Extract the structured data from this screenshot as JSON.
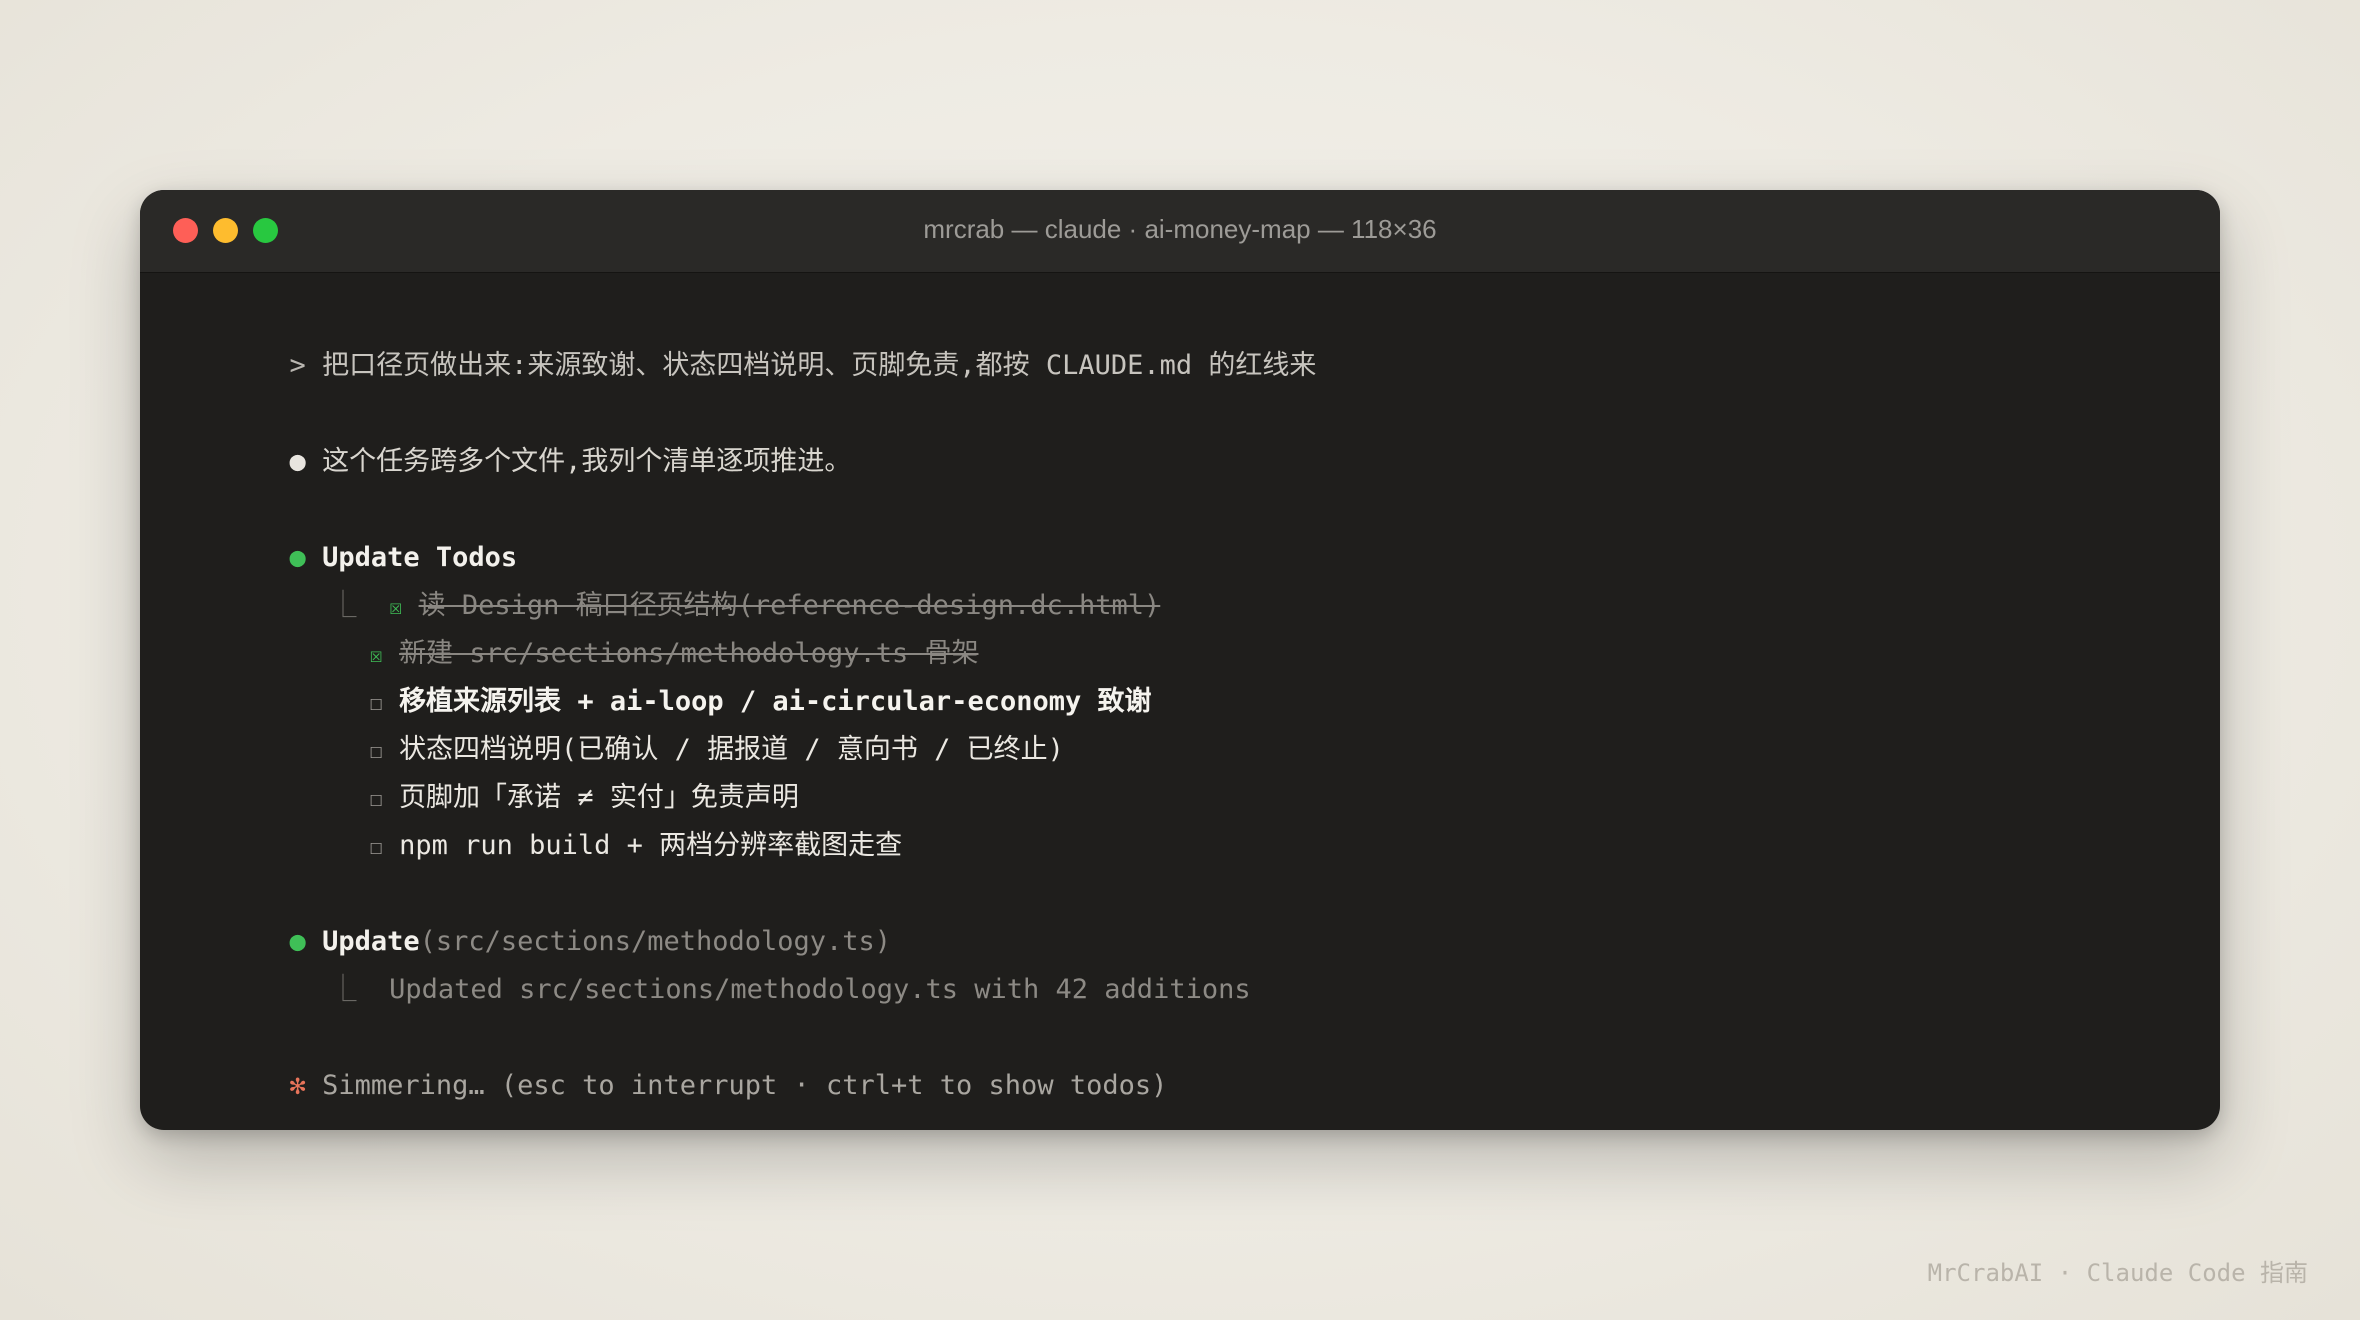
{
  "window": {
    "title": "mrcrab — claude · ai-money-map — 118×36"
  },
  "prompt": {
    "mark": ">",
    "text": "把口径页做出来:来源致谢、状态四档说明、页脚免责,都按 CLAUDE.md 的红线来"
  },
  "reply": {
    "text": "这个任务跨多个文件,我列个清单逐项推进。"
  },
  "todos": {
    "heading": "Update Todos",
    "items": [
      {
        "check": "☒",
        "label": "读 Design 稿口径页结构(reference-design.dc.html)",
        "status": "done"
      },
      {
        "check": "☒",
        "label": "新建 src/sections/methodology.ts 骨架",
        "status": "done"
      },
      {
        "check": "☐",
        "label": "移植来源列表 + ai-loop / ai-circular-economy 致谢",
        "status": "in_progress"
      },
      {
        "check": "☐",
        "label": "状态四档说明(已确认 / 据报道 / 意向书 / 已终止)",
        "status": "pending"
      },
      {
        "check": "☐",
        "label": "页脚加「承诺 ≠ 实付」免责声明",
        "status": "pending"
      },
      {
        "check": "☐",
        "label": "npm run build + 两档分辨率截图走查",
        "status": "pending"
      }
    ]
  },
  "update": {
    "tool": "Update",
    "args": "(src/sections/methodology.ts)",
    "result": "Updated src/sections/methodology.ts with 42 additions"
  },
  "status": {
    "spinner": "✻",
    "text": "Simmering… (esc to interrupt · ctrl+t to show todos)"
  },
  "watermark": "MrCrabAI · Claude Code 指南",
  "colors": {
    "terminal_bg": "#1f1e1c",
    "titlebar_bg": "#2a2927",
    "accent_green": "#3fbf57",
    "spinner_orange": "#e8745a",
    "close": "#fe5f57",
    "minimize": "#febc2e",
    "zoom": "#28c840"
  }
}
